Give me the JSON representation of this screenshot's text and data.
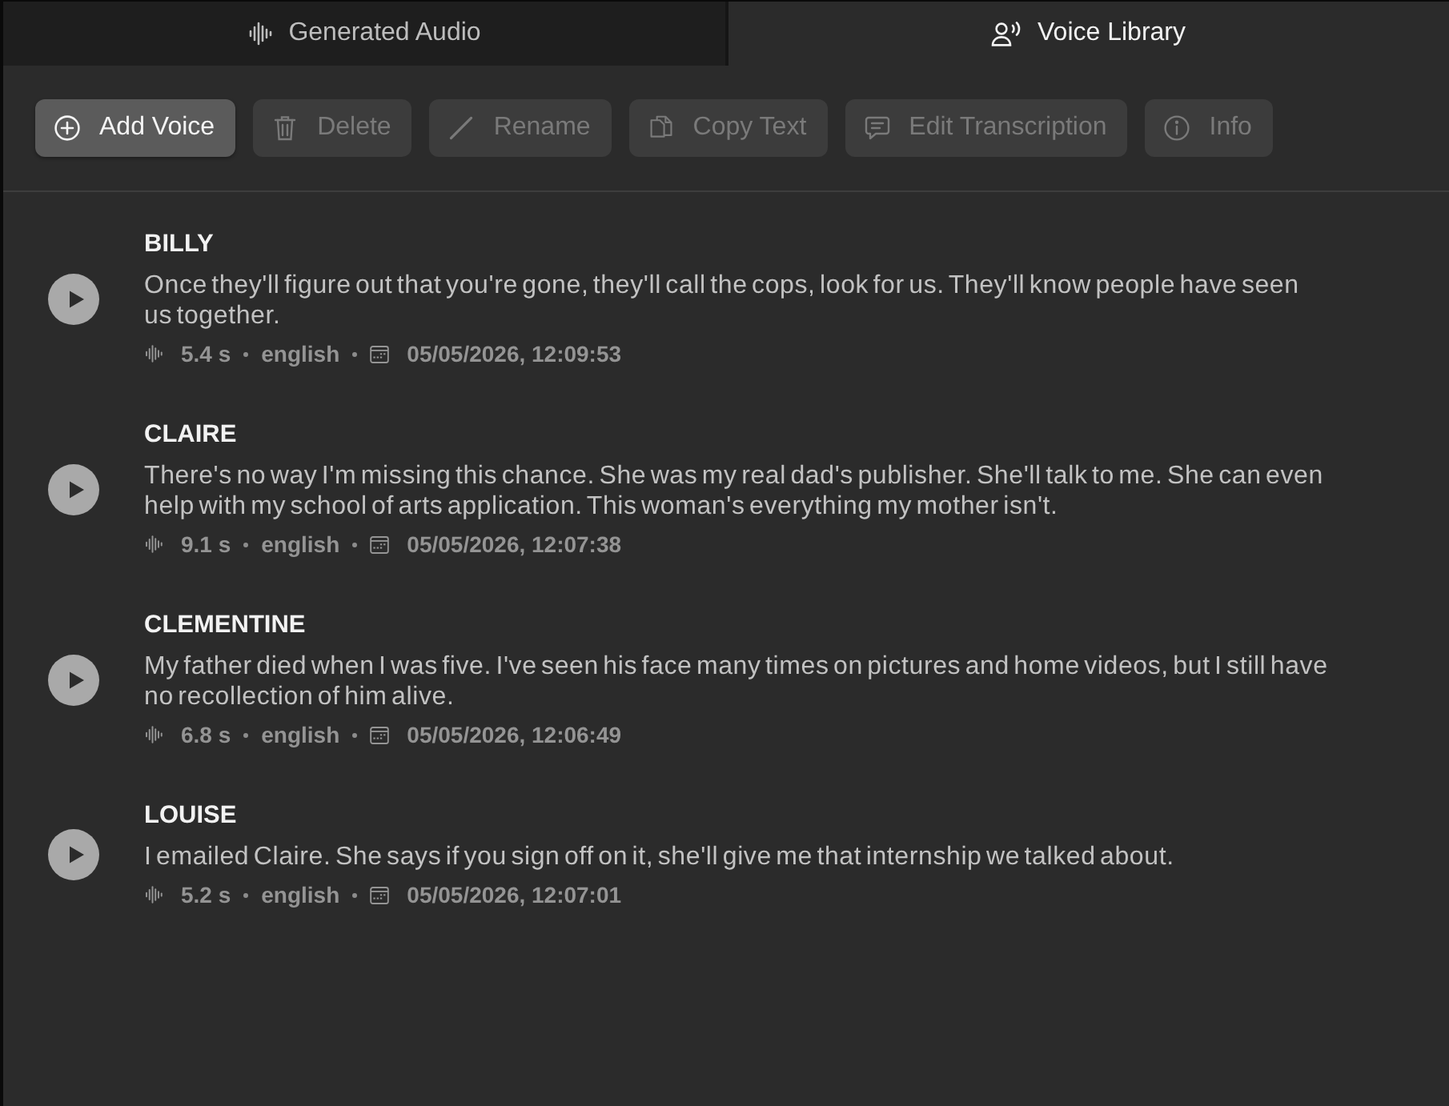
{
  "tabs": [
    {
      "label": "Generated Audio",
      "selected": false
    },
    {
      "label": "Voice Library",
      "selected": true
    }
  ],
  "toolbar": {
    "buttons": [
      {
        "label": "Add Voice",
        "disabled": false
      },
      {
        "label": "Delete",
        "disabled": true
      },
      {
        "label": "Rename",
        "disabled": true
      },
      {
        "label": "Copy Text",
        "disabled": true
      },
      {
        "label": "Edit Transcription",
        "disabled": true
      },
      {
        "label": "Info",
        "disabled": true
      }
    ]
  },
  "voices": [
    {
      "name": "BILLY",
      "transcript": "Once they'll figure out that you're gone, they'll call the cops, look for us. They'll know people have seen us together.",
      "duration": "5.4 s",
      "language": "english",
      "created": "05/05/2026, 12:09:53"
    },
    {
      "name": "CLAIRE",
      "transcript": "There's no way I'm missing this chance. She was my real dad's publisher. She'll talk to me. She can even help with my school of arts application. This woman's everything my mother isn't.",
      "duration": "9.1 s",
      "language": "english",
      "created": "05/05/2026, 12:07:38"
    },
    {
      "name": "CLEMENTINE",
      "transcript": "My father died when I was five. I've seen his face many times on pictures and home videos, but I still have no recollection of him alive.",
      "duration": "6.8 s",
      "language": "english",
      "created": "05/05/2026, 12:06:49"
    },
    {
      "name": "LOUISE",
      "transcript": "I emailed Claire. She says if you sign off on it, she'll give me that internship we talked about.",
      "duration": "5.2 s",
      "language": "english",
      "created": "05/05/2026, 12:07:01"
    }
  ]
}
